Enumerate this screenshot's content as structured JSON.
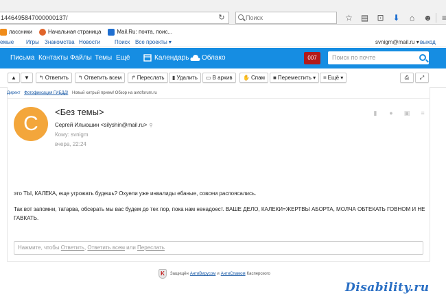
{
  "browser": {
    "url": "1446495847000000137/",
    "search_placeholder": "Поиск"
  },
  "bookmarks": [
    {
      "label": "лассники",
      "color": "#f08c1a"
    },
    {
      "label": "Начальная страница",
      "color": "#e0652b"
    },
    {
      "label": "Mail.Ru: почта, поис...",
      "color": "#1f6fd0"
    }
  ],
  "topline": {
    "links": [
      "емые",
      "Игры",
      "Знакомства",
      "Новости",
      "Поиск",
      "Все проекты ▾"
    ],
    "user": "svnigm@mail.ru ▾",
    "logout": "выход"
  },
  "nav": {
    "items": [
      "Письма",
      "Контакты",
      "Файлы",
      "Темы",
      "Ещё"
    ],
    "calendar": "Календарь",
    "cloud": "Облако",
    "counter": "007",
    "search_placeholder": "Поиск по почте"
  },
  "toolbar": {
    "up": "▲",
    "down": "▼",
    "reply": "Ответить",
    "reply_all": "Ответить всем",
    "forward": "Переслать",
    "delete": "Удалить",
    "archive": "В архив",
    "spam": "Спам",
    "move": "Переместить",
    "more": "Ещё"
  },
  "ad": {
    "label": "Директ",
    "title": "Фотофиксация ГИБДД!",
    "text": "Новый хитрый прием! Обзор на avtoforum.ru"
  },
  "message": {
    "avatar_letter": "С",
    "subject": "<Без темы>",
    "sender": "Сергей Ильюшин <silyshin@mail.ru>",
    "to": "Кому: svnigm",
    "date": "вчера, 22:24",
    "body": [
      "это ТЫ, КАЛЕКА, еще угрожать будешь? Охуели уже инвалиды ебаные, совсем распоясались.",
      "Так вот запомни, татарва, обсерать мы вас будем до тех пор, пока нам ненадоест.  ВАШЕ ДЕЛО, КАЛЕКИ=ЖЕРТВЫ АБОРТА, МОЛЧА ОБТЕКАТЬ ГОВНОМ И НЕ ГАВКАТЬ."
    ]
  },
  "reply_box": {
    "prefix": "Нажмите, чтобы ",
    "reply": "Ответить",
    "sep": ", ",
    "reply_all": "Ответить всем",
    "or": " или ",
    "forward": "Переслать"
  },
  "protection": {
    "prefix": "Защищён",
    "antivirus": "АнтиВирусом",
    "and": "и",
    "antispam": "АнтиСпамом",
    "suffix": "Касперского"
  },
  "watermark": "Disability.ru"
}
